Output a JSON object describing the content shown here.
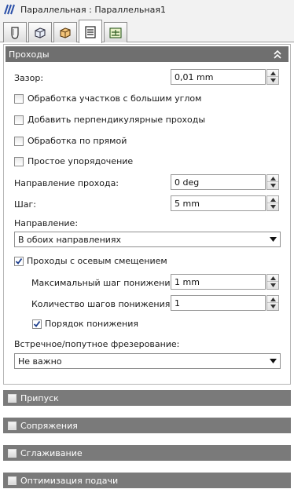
{
  "window": {
    "title": "Параллельная : Параллельная1",
    "app_icon": "parallel-passes-icon"
  },
  "tabs": [
    {
      "name": "tool",
      "icon": "tool-icon",
      "active": false
    },
    {
      "name": "stock",
      "icon": "stock-box-icon",
      "active": false
    },
    {
      "name": "geometry",
      "icon": "geometry-box-icon",
      "active": false
    },
    {
      "name": "passes",
      "icon": "passes-icon",
      "active": true
    },
    {
      "name": "linking",
      "icon": "linking-icon",
      "active": false
    }
  ],
  "passes_section": {
    "title": "Проходы",
    "tolerance": {
      "label": "Зазор:",
      "value": "0,01 mm"
    },
    "steep_areas": {
      "label": "Обработка участков с большим углом",
      "checked": false
    },
    "perpendicular_passes": {
      "label": "Добавить перпендикулярные проходы",
      "checked": false
    },
    "straight_machining": {
      "label": "Обработка по прямой",
      "checked": false
    },
    "simple_ordering": {
      "label": "Простое упорядочение",
      "checked": false
    },
    "pass_direction": {
      "label": "Направление прохода:",
      "value": "0 deg"
    },
    "stepover": {
      "label": "Шаг:",
      "value": "5 mm"
    },
    "direction": {
      "label": "Направление:",
      "selected": "В обоих направлениях"
    },
    "axial_offset": {
      "label": "Проходы с осевым смещением",
      "checked": true
    },
    "max_stepdown": {
      "label": "Максимальный шаг понижения:",
      "value": "1 mm"
    },
    "num_stepdowns": {
      "label": "Количество шагов понижения:",
      "value": "1"
    },
    "stepdown_order": {
      "label": "Порядок понижения",
      "checked": true
    },
    "milling_mode": {
      "label": "Встречное/попутное фрезерование:",
      "selected": "Не важно"
    }
  },
  "collapsed_sections": [
    {
      "label": "Припуск",
      "checked": false
    },
    {
      "label": "Сопряжения",
      "checked": false
    },
    {
      "label": "Сглаживание",
      "checked": false
    },
    {
      "label": "Оптимизация подачи",
      "checked": false
    }
  ],
  "colors": {
    "section_header": "#7a7a7a",
    "panel_border": "#b5b5b5",
    "checkmark": "#1a3c8c"
  }
}
